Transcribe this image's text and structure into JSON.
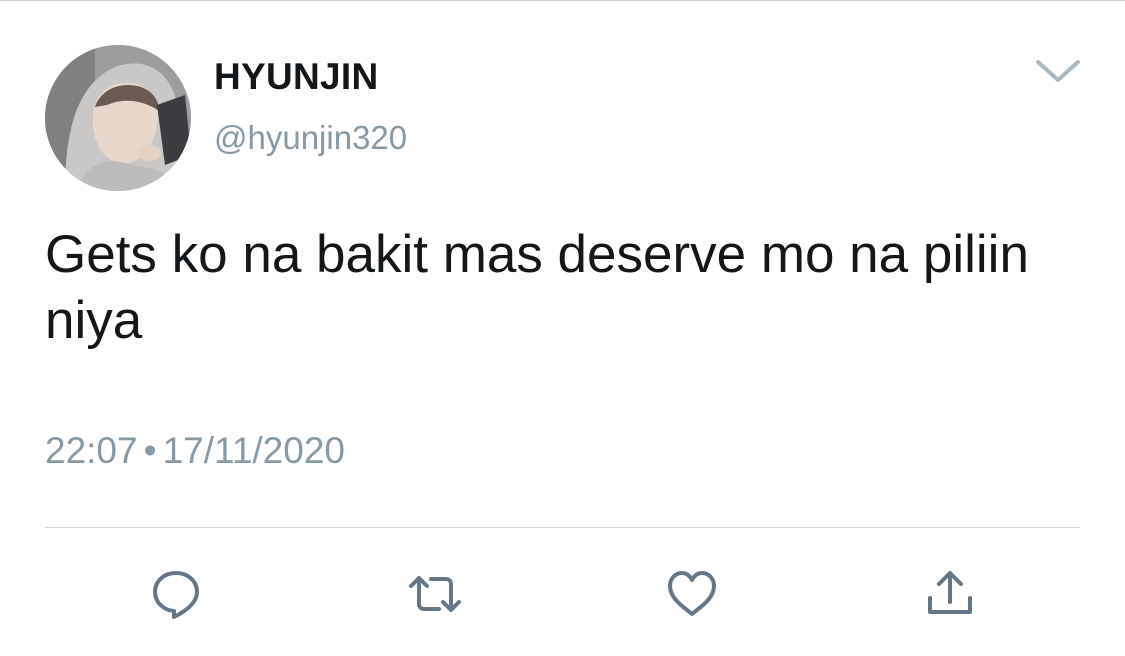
{
  "tweet": {
    "display_name": "HYUNJIN",
    "handle": "@hyunjin320",
    "text": "Gets ko na bakit mas deserve mo na piliin niya",
    "time": "22:07",
    "separator": "•",
    "date": "17/11/2020"
  },
  "icons": {
    "avatar": "profile-photo",
    "menu": "chevron-down-icon",
    "reply": "reply-bubble-icon",
    "retweet": "retweet-icon",
    "like": "heart-icon",
    "share": "share-upload-icon"
  },
  "colors": {
    "text_primary": "#14171a",
    "text_secondary": "#8899a6",
    "icon_gray": "#657786",
    "divider": "#ccd6dd"
  }
}
